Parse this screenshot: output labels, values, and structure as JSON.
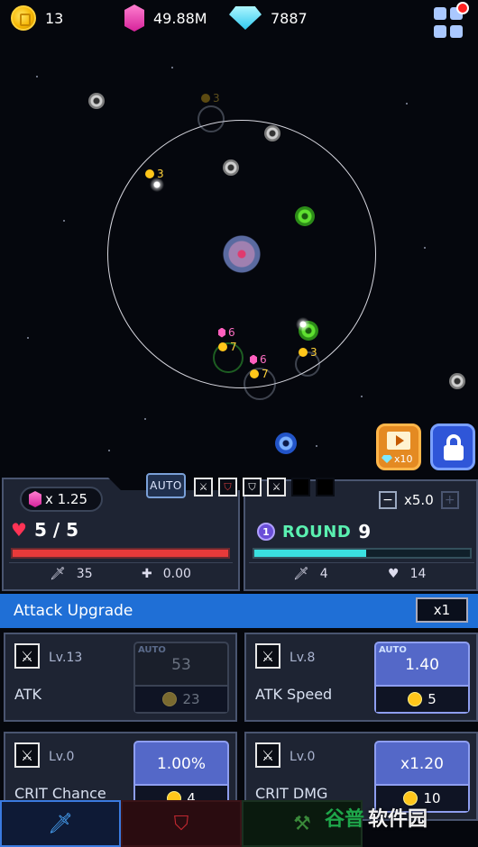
{
  "resources": {
    "coins": "13",
    "gems": "49.88M",
    "diamonds": "7887"
  },
  "battle": {
    "drops": [
      {
        "kind": "coin",
        "amount": "3"
      },
      {
        "kind": "coin",
        "amount": "3"
      },
      {
        "kind": "gem",
        "amount": "6"
      },
      {
        "kind": "coin",
        "amount": "7"
      },
      {
        "kind": "gem",
        "amount": "6"
      },
      {
        "kind": "coin",
        "amount": "7"
      },
      {
        "kind": "coin",
        "amount": "3"
      }
    ],
    "video_reward": "x10"
  },
  "left_panel": {
    "gem_multiplier": "x 1.25",
    "auto_label": "AUTO",
    "hp": "5 / 5",
    "hp_fraction": 1.0,
    "attack": "35",
    "regen": "0.00"
  },
  "right_panel": {
    "speed": "x5.0",
    "round_badge": "1",
    "round_label": "ROUND",
    "round_number": "9",
    "round_progress": 0.52,
    "stat_attack": "4",
    "stat_health": "14"
  },
  "upgrade": {
    "header": "Attack Upgrade",
    "multiplier": "x1",
    "cards": [
      {
        "level": "Lv.13",
        "name": "ATK",
        "auto": "AUTO",
        "value": "53",
        "cost": "23",
        "affordable": false
      },
      {
        "level": "Lv.8",
        "name": "ATK Speed",
        "auto": "AUTO",
        "value": "1.40",
        "cost": "5",
        "affordable": true
      },
      {
        "level": "Lv.0",
        "name": "CRIT Chance",
        "value": "1.00%",
        "cost": "4",
        "affordable": true
      },
      {
        "level": "Lv.0",
        "name": "CRIT DMG",
        "value": "x1.20",
        "cost": "10",
        "affordable": true
      }
    ]
  },
  "watermark": {
    "part1": "谷普",
    "part2": "软件园"
  },
  "colors": {
    "accent_blue": "#1f6fd6",
    "hp_red": "#e83a3a",
    "round_cyan": "#3ae0e0",
    "round_label_green": "#5af0b0"
  }
}
